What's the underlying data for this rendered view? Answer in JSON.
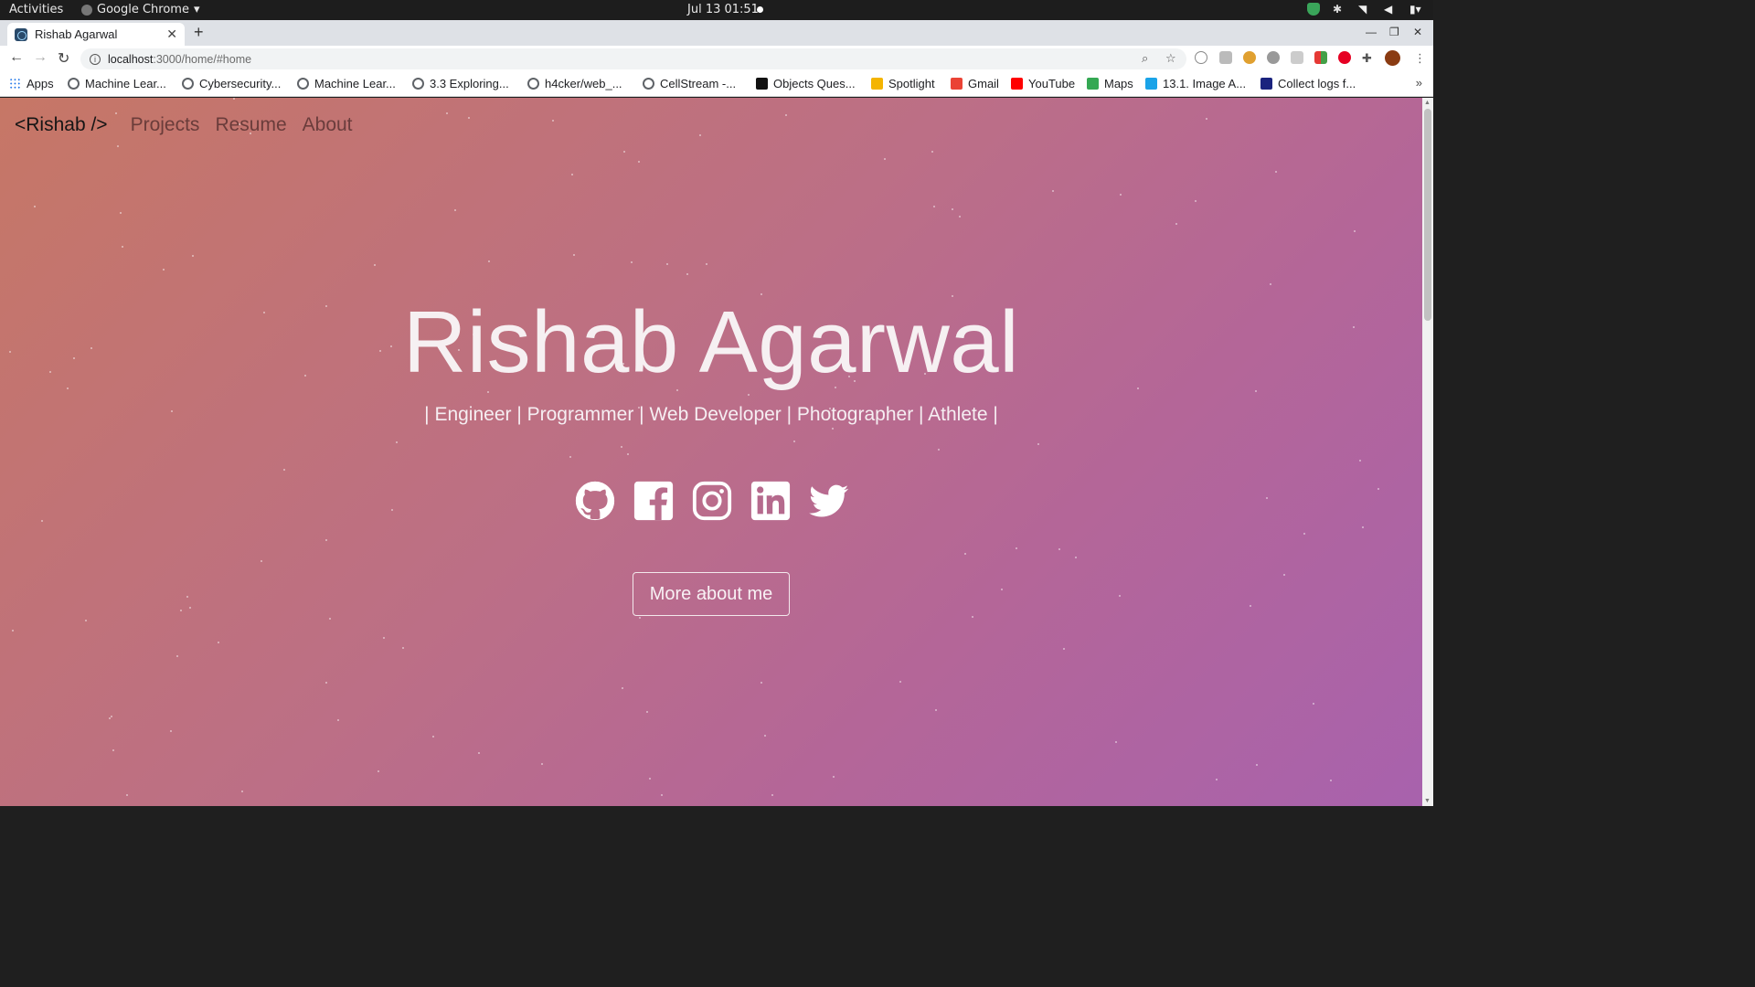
{
  "system_bar": {
    "activities": "Activities",
    "app_name": "Google Chrome",
    "clock": "Jul 13  01:51"
  },
  "browser": {
    "tab_title": "Rishab Agarwal",
    "url_host": "localhost",
    "url_path": ":3000/home/#home",
    "bookmarks": [
      {
        "label": "Apps",
        "icon": "apps-grid-icon",
        "color": "#1a73e8"
      },
      {
        "label": "Machine Lear...",
        "icon": "globe-icon",
        "color": "#5f6368"
      },
      {
        "label": "Cybersecurity...",
        "icon": "globe-icon",
        "color": "#5f6368"
      },
      {
        "label": "Machine Lear...",
        "icon": "globe-icon",
        "color": "#5f6368"
      },
      {
        "label": "3.3 Exploring...",
        "icon": "globe-icon",
        "color": "#5f6368"
      },
      {
        "label": "h4cker/web_...",
        "icon": "globe-icon",
        "color": "#5f6368"
      },
      {
        "label": "CellStream -...",
        "icon": "globe-icon",
        "color": "#5f6368"
      },
      {
        "label": "Objects Ques...",
        "icon": "sf-icon",
        "color": "#111111"
      },
      {
        "label": "Spotlight",
        "icon": "spotlight-icon",
        "color": "#f4b400"
      },
      {
        "label": "Gmail",
        "icon": "gmail-icon",
        "color": "#ea4335"
      },
      {
        "label": "YouTube",
        "icon": "youtube-icon",
        "color": "#ff0000"
      },
      {
        "label": "Maps",
        "icon": "maps-icon",
        "color": "#34a853"
      },
      {
        "label": "13.1. Image A...",
        "icon": "image-icon",
        "color": "#1aa3e8"
      },
      {
        "label": "Collect logs f...",
        "icon": "logs-icon",
        "color": "#1a237e"
      }
    ]
  },
  "site": {
    "brand": "<Rishab />",
    "nav": [
      "Projects",
      "Resume",
      "About"
    ],
    "hero_name": "Rishab Agarwal",
    "hero_subtitle": "| Engineer | Programmer | Web Developer | Photographer | Athlete |",
    "socials": [
      "github-icon",
      "facebook-icon",
      "instagram-icon",
      "linkedin-icon",
      "twitter-icon"
    ],
    "cta": "More about me"
  },
  "colors": {
    "gradient_start": "#c67766",
    "gradient_end": "#a862ad",
    "hero_text": "#f6f0f2"
  }
}
